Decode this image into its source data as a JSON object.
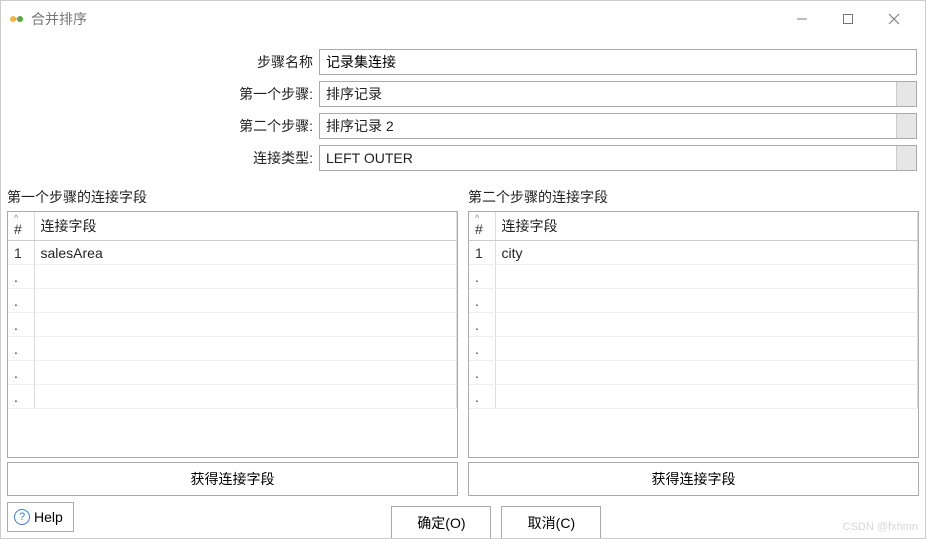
{
  "titlebar": {
    "title": "合并排序"
  },
  "form": {
    "step_name_label": "步骤名称",
    "step_name_value": "记录集连接",
    "first_step_label": "第一个步骤:",
    "first_step_value": "排序记录",
    "second_step_label": "第二个步骤:",
    "second_step_value": "排序记录 2",
    "join_type_label": "连接类型:",
    "join_type_value": "LEFT OUTER"
  },
  "left_panel": {
    "title": "第一个步骤的连接字段",
    "col_num": "#",
    "col_field": "连接字段",
    "rows": [
      {
        "n": "1",
        "field": "salesArea"
      }
    ],
    "get_button": "获得连接字段"
  },
  "right_panel": {
    "title": "第二个步骤的连接字段",
    "col_num": "#",
    "col_field": "连接字段",
    "rows": [
      {
        "n": "1",
        "field": "city"
      }
    ],
    "get_button": "获得连接字段"
  },
  "footer": {
    "help": "Help",
    "ok": "确定(O)",
    "cancel": "取消(C)"
  },
  "watermark": "CSDN @fxhmn"
}
